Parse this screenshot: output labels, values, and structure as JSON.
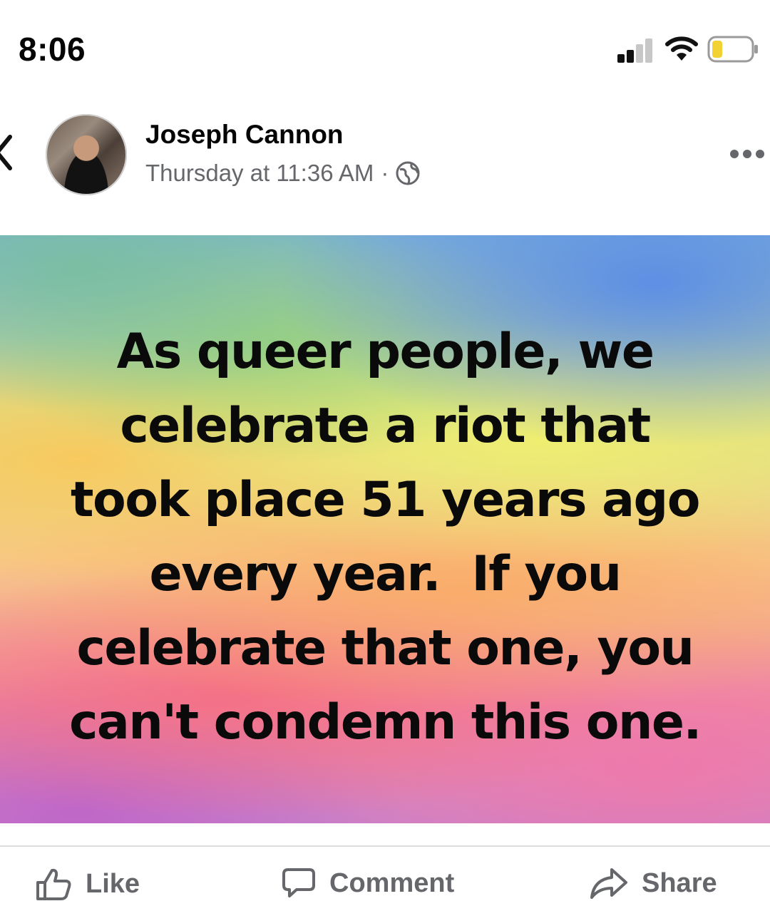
{
  "status_bar": {
    "time": "8:06"
  },
  "post": {
    "author": "Joseph Cannon",
    "timestamp": "Thursday at 11:36 AM",
    "separator": "·",
    "image_text_lines": [
      "As queer people, we",
      "celebrate a riot that",
      "took place 51 years ago",
      "every year.  If you",
      "celebrate that one, you",
      "can't condemn this one."
    ]
  },
  "actions": {
    "like": "Like",
    "comment": "Comment",
    "share": "Share"
  },
  "icons": {
    "back": "chevron-left-icon",
    "more": "more-dots-icon",
    "audience": "globe-icon",
    "like": "thumbs-up-icon",
    "comment": "speech-bubble-icon",
    "share": "share-arrow-icon"
  },
  "colors": {
    "secondary_text": "#65676b",
    "battery_fill": "#f2d233"
  }
}
